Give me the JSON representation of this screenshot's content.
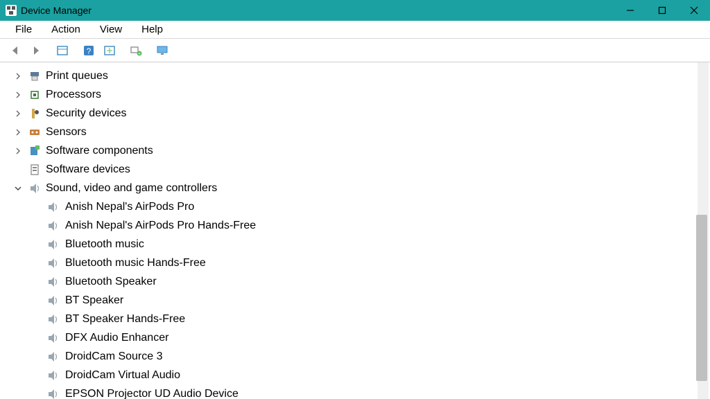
{
  "window": {
    "title": "Device Manager"
  },
  "menubar": {
    "file": "File",
    "action": "Action",
    "view": "View",
    "help": "Help"
  },
  "categories": [
    {
      "label": "Print queues",
      "expanded": false,
      "icon": "printer"
    },
    {
      "label": "Processors",
      "expanded": false,
      "icon": "cpu"
    },
    {
      "label": "Security devices",
      "expanded": false,
      "icon": "security"
    },
    {
      "label": "Sensors",
      "expanded": false,
      "icon": "sensor"
    },
    {
      "label": "Software components",
      "expanded": false,
      "icon": "software-comp"
    },
    {
      "label": "Software devices",
      "expanded": false,
      "icon": "software-dev"
    },
    {
      "label": "Sound, video and game controllers",
      "expanded": true,
      "icon": "speaker",
      "children": [
        "Anish Nepal's AirPods Pro",
        "Anish Nepal's AirPods Pro Hands-Free",
        "Bluetooth music",
        "Bluetooth music Hands-Free",
        "Bluetooth Speaker",
        "BT Speaker",
        "BT Speaker Hands-Free",
        "DFX Audio Enhancer",
        "DroidCam Source 3",
        "DroidCam Virtual Audio",
        "EPSON Projector UD Audio Device"
      ]
    }
  ]
}
